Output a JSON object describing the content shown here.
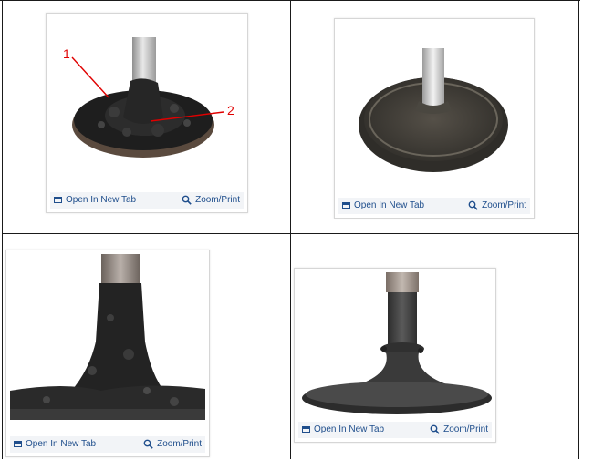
{
  "cards": [
    {
      "open_label": "Open In New Tab",
      "zoom_label": "Zoom/Print",
      "callout_1": "1",
      "callout_2": "2"
    },
    {
      "open_label": "Open In New Tab",
      "zoom_label": "Zoom/Print"
    },
    {
      "open_label": "Open In New Tab",
      "zoom_label": "Zoom/Print"
    },
    {
      "open_label": "Open In New Tab",
      "zoom_label": "Zoom/Print"
    }
  ],
  "colors": {
    "link": "#1f4e8c",
    "callout": "#e00000",
    "grid": "#1a1a1a"
  },
  "icons": {
    "open": "open-new-tab-icon",
    "zoom": "zoom-magnifier-icon"
  }
}
